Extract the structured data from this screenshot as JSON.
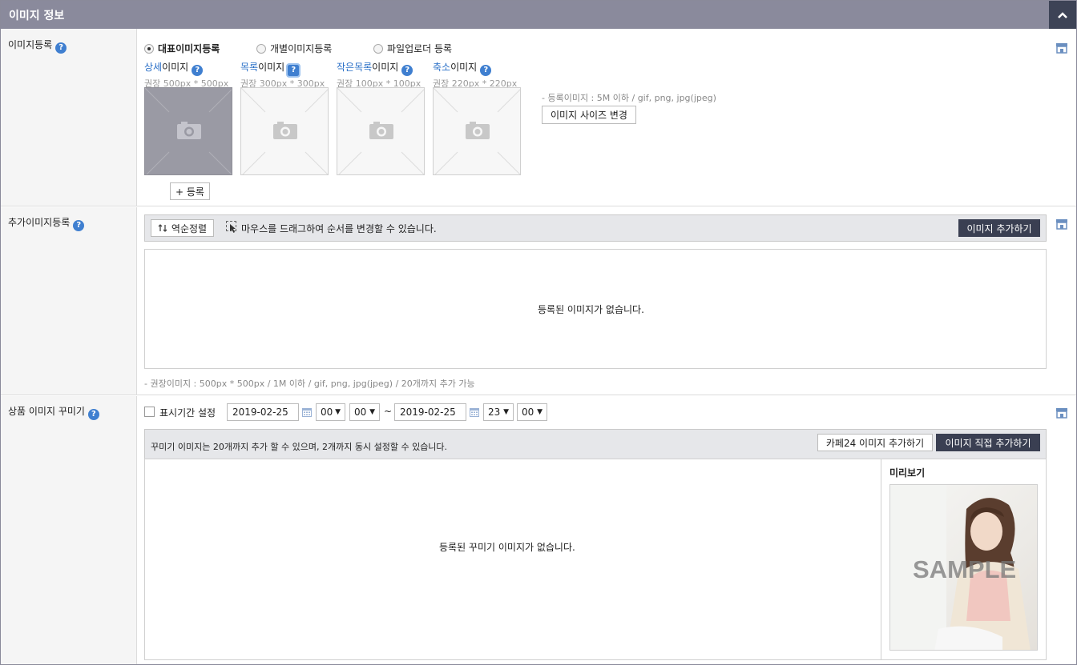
{
  "header": {
    "title": "이미지 정보"
  },
  "rows": {
    "image_register": {
      "label": "이미지등록",
      "radios": [
        {
          "label": "대표이미지등록",
          "selected": true
        },
        {
          "label": "개별이미지등록",
          "selected": false
        },
        {
          "label": "파일업로더 등록",
          "selected": false
        }
      ],
      "images": [
        {
          "blue": "상세",
          "rest": "이미지",
          "recommend": "권장 500px * 500px"
        },
        {
          "blue": "목록",
          "rest": "이미지",
          "recommend": "권장 300px * 300px"
        },
        {
          "blue": "작은목록",
          "rest": "이미지",
          "recommend": "권장 100px * 100px"
        },
        {
          "blue": "축소",
          "rest": "이미지",
          "recommend": "권장 220px * 220px"
        }
      ],
      "register_button": "+ 등록",
      "size_note": "- 등록이미지 : 5M 이하 / gif, png, jpg(jpeg)",
      "size_change_button": "이미지 사이즈 변경"
    },
    "additional_images": {
      "label": "추가이미지등록",
      "reverse_button": "역순정렬",
      "drag_hint": "마우스를 드래그하여 순서를 변경할 수 있습니다.",
      "add_button": "이미지 추가하기",
      "empty_text": "등록된 이미지가 없습니다.",
      "note": "- 권장이미지 : 500px * 500px / 1M 이하 / gif, png, jpg(jpeg) / 20개까지 추가 가능"
    },
    "decoration": {
      "label": "상품 이미지 꾸미기",
      "period_label": "표시기간 설정",
      "start_date": "2019-02-25",
      "start_hour": "00",
      "start_min": "00",
      "tilde": "~",
      "end_date": "2019-02-25",
      "end_hour": "23",
      "end_min": "00",
      "info_text": "꾸미기 이미지는 20개까지 추가 할 수 있으며, 2개까지 동시 설정할 수 있습니다.",
      "cafe24_button": "카페24 이미지 추가하기",
      "direct_button": "이미지 직접 추가하기",
      "empty_text": "등록된 꾸미기 이미지가 없습니다.",
      "preview_label": "미리보기",
      "sample_text": "SAMPLE"
    }
  },
  "colors": {
    "header_bg": "#8a8a9c",
    "dark_button": "#3a3f52",
    "help_blue": "#3f7fd0",
    "link_blue": "#2a6fc7"
  },
  "icons": {
    "help": "question-circle-icon",
    "collapse": "chevron-up-icon",
    "store": "store-icon",
    "camera": "camera-icon",
    "calendar": "calendar-icon",
    "sort": "swap-icon"
  }
}
